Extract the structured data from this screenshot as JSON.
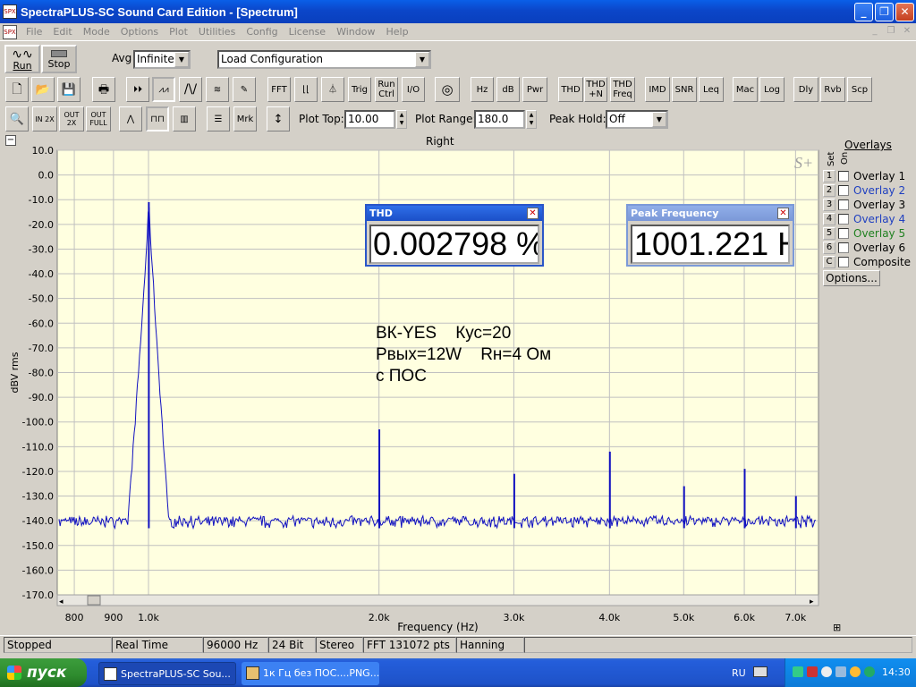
{
  "window": {
    "title": "SpectraPLUS-SC Sound Card Edition - [Spectrum]",
    "app_icon_text": "SPX"
  },
  "menu": [
    "File",
    "Edit",
    "Mode",
    "Options",
    "Plot",
    "Utilities",
    "Config",
    "License",
    "Window",
    "Help"
  ],
  "toolbar1": {
    "run_label": "Run",
    "stop_label": "Stop",
    "avg_label": "Avg",
    "avg_value": "Infinite",
    "config_value": "Load Configuration"
  },
  "toolbar2": [
    "FFT",
    "Trig",
    "Run Ctrl",
    "I/O",
    "Hz",
    "dB",
    "Pwr",
    "THD",
    "THD +N",
    "THD Freq",
    "IMD",
    "SNR",
    "Leq",
    "Mac",
    "Log",
    "Dly",
    "Rvb",
    "Scp"
  ],
  "toolbar3": {
    "mrk": "Mrk",
    "plot_top_label": "Plot Top:",
    "plot_top_value": "10.00",
    "plot_range_label": "Plot Range:",
    "plot_range_value": "180.0",
    "peak_hold_label": "Peak Hold:",
    "peak_hold_value": "Off",
    "zoom_in": "IN 2X",
    "zoom_out": "OUT 2X",
    "zoom_full": "OUT FULL"
  },
  "plot": {
    "channel_title": "Right",
    "collapse_symbol": "⊟",
    "logo": "S+"
  },
  "overlays": {
    "title": "Overlays",
    "col_set": "Set",
    "col_on": "On",
    "items": [
      {
        "num": "1",
        "label": "Overlay 1",
        "color": "#000000"
      },
      {
        "num": "2",
        "label": "Overlay 2",
        "color": "#2040c0"
      },
      {
        "num": "3",
        "label": "Overlay 3",
        "color": "#000000"
      },
      {
        "num": "4",
        "label": "Overlay 4",
        "color": "#2040c0"
      },
      {
        "num": "5",
        "label": "Overlay 5",
        "color": "#208020"
      },
      {
        "num": "6",
        "label": "Overlay 6",
        "color": "#000000"
      },
      {
        "num": "C",
        "label": "Composite",
        "color": "#000000"
      }
    ],
    "options_label": "Options..."
  },
  "thd_meter": {
    "title": "THD",
    "value": "0.002798 %"
  },
  "peak_meter": {
    "title": "Peak Frequency",
    "value": "1001.221 H"
  },
  "annotation": {
    "line1": "ВК-YES    Кус=20",
    "line2": "Рвых=12W    Rн=4 Ом",
    "line3": "с ПОС"
  },
  "chart_data": {
    "type": "line",
    "title": "Right",
    "xlabel": "Frequency (Hz)",
    "ylabel": "dBV rms",
    "x_scale": "log",
    "xlim": [
      760,
      7500
    ],
    "ylim": [
      -170,
      10
    ],
    "x_ticks": [
      {
        "v": 800,
        "label": "800"
      },
      {
        "v": 900,
        "label": "900"
      },
      {
        "v": 1000,
        "label": "1.0k"
      },
      {
        "v": 2000,
        "label": "2.0k"
      },
      {
        "v": 3000,
        "label": "3.0k"
      },
      {
        "v": 4000,
        "label": "4.0k"
      },
      {
        "v": 5000,
        "label": "5.0k"
      },
      {
        "v": 6000,
        "label": "6.0k"
      },
      {
        "v": 7000,
        "label": "7.0k"
      }
    ],
    "y_ticks": [
      {
        "v": 10,
        "label": "10.0"
      },
      {
        "v": 0,
        "label": "0.0"
      },
      {
        "v": -10,
        "label": "-10.0"
      },
      {
        "v": -20,
        "label": "-20.0"
      },
      {
        "v": -30,
        "label": "-30.0"
      },
      {
        "v": -40,
        "label": "-40.0"
      },
      {
        "v": -50,
        "label": "-50.0"
      },
      {
        "v": -60,
        "label": "-60.0"
      },
      {
        "v": -70,
        "label": "-70.0"
      },
      {
        "v": -80,
        "label": "-80.0"
      },
      {
        "v": -90,
        "label": "-90.0"
      },
      {
        "v": -100,
        "label": "-100.0"
      },
      {
        "v": -110,
        "label": "-110.0"
      },
      {
        "v": -120,
        "label": "-120.0"
      },
      {
        "v": -130,
        "label": "-130.0"
      },
      {
        "v": -140,
        "label": "-140.0"
      },
      {
        "v": -150,
        "label": "-150.0"
      },
      {
        "v": -160,
        "label": "-160.0"
      },
      {
        "v": -170,
        "label": "-170.0"
      }
    ],
    "noise_floor_dbv": -141,
    "series": [
      {
        "color": "#1010c0",
        "peaks": [
          {
            "x": 1001,
            "y": -11
          },
          {
            "x": 2002,
            "y": -103
          },
          {
            "x": 3004,
            "y": -121
          },
          {
            "x": 4005,
            "y": -112
          },
          {
            "x": 5006,
            "y": -126
          },
          {
            "x": 6007,
            "y": -119
          },
          {
            "x": 7008,
            "y": -130
          }
        ]
      }
    ],
    "background": "#ffffe0",
    "grid": true
  },
  "status": [
    "Stopped",
    "Real Time",
    "96000 Hz",
    "24 Bit",
    "Stereo",
    "FFT 131072 pts",
    "Hanning"
  ],
  "taskbar": {
    "start_label": "пуск",
    "tasks": [
      "SpectraPLUS-SC Sou...",
      "1к Гц без ПОС....PNG..."
    ],
    "lang": "RU",
    "time": "14:30"
  }
}
